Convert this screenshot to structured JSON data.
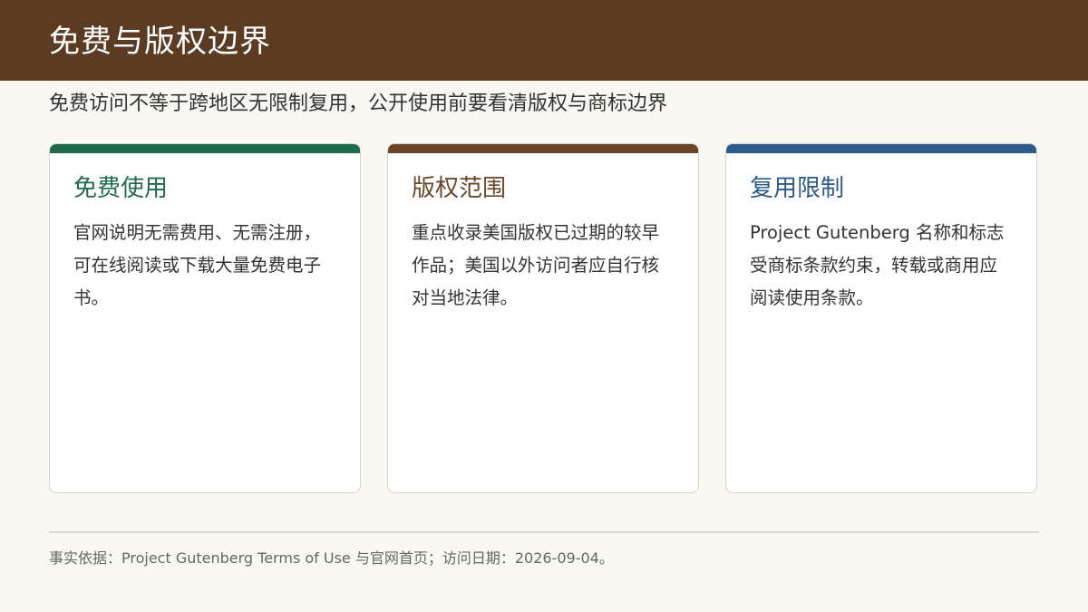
{
  "header": {
    "title": "免费与版权边界"
  },
  "subtitle": "免费访问不等于跨地区无限制复用，公开使用前要看清版权与商标边界",
  "cards": [
    {
      "title": "免费使用",
      "body": "官网说明无需费用、无需注册，可在线阅读或下载大量免费电子书。",
      "accent": "#1f6b4f"
    },
    {
      "title": "版权范围",
      "body": "重点收录美国版权已过期的较早作品；美国以外访问者应自行核对当地法律。",
      "accent": "#6b4626"
    },
    {
      "title": "复用限制",
      "body": "Project Gutenberg 名称和标志受商标条款约束，转载或商用应阅读使用条款。",
      "accent": "#2c5a8a"
    }
  ],
  "footer": "事实依据：Project Gutenberg Terms of Use 与官网首页；访问日期：2026-09-04。"
}
